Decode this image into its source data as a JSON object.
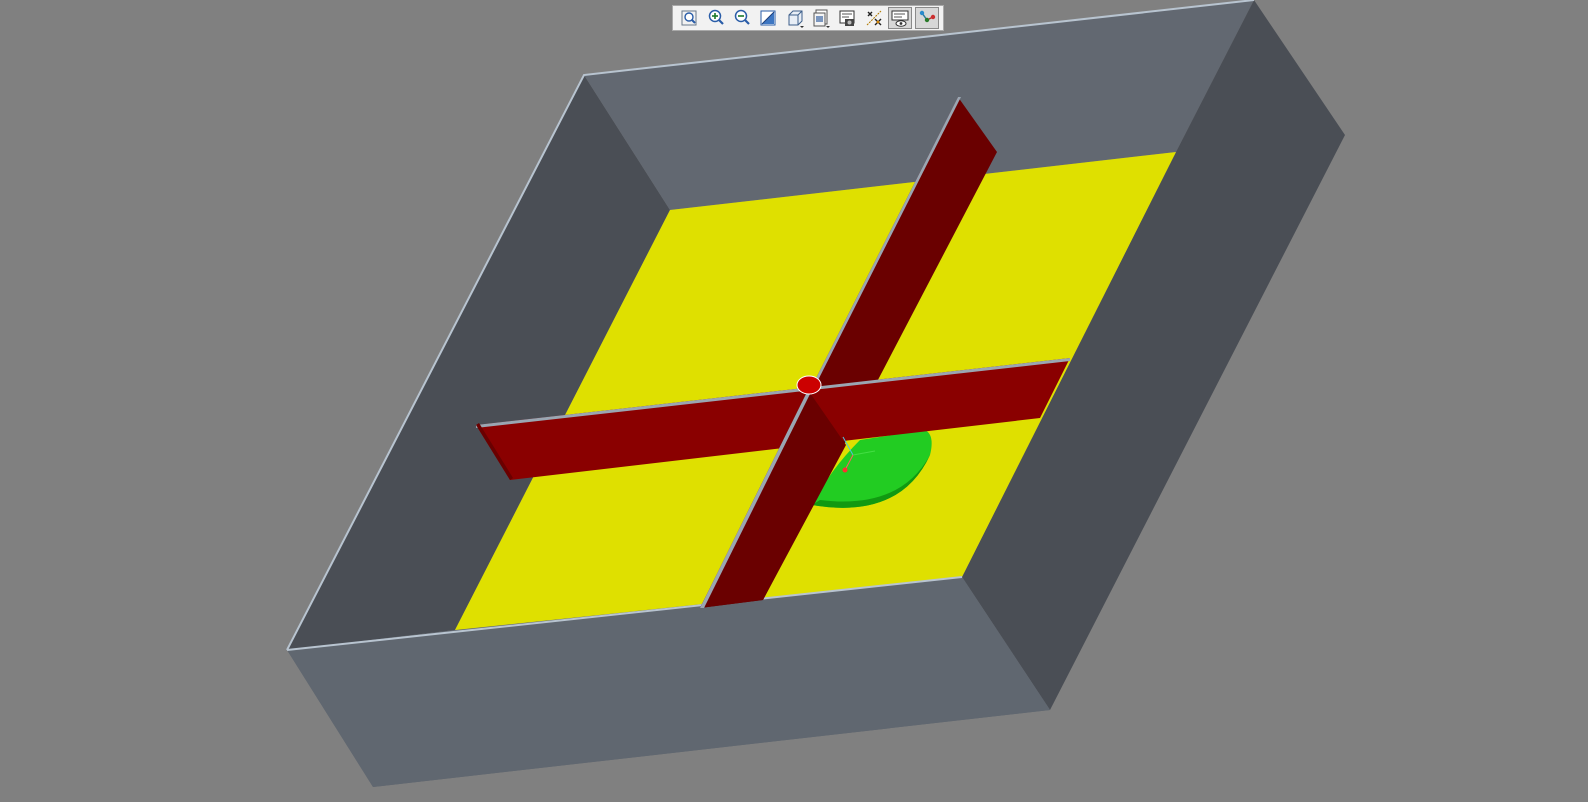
{
  "viewport": {
    "background_color": "#808080"
  },
  "colors": {
    "box_outer": "#606770",
    "box_wall_dark": "#4a4e55",
    "box_wall_light": "#646a73",
    "floor": "#dfe000",
    "beam": "#8a0000",
    "beam_dark": "#6a0000",
    "dome": "#22cc22",
    "edge_highlight": "#b8c4d0"
  },
  "toolbar": {
    "buttons": [
      {
        "icon": "zoom-fit-icon",
        "tooltip": "",
        "active": false
      },
      {
        "icon": "zoom-in-icon",
        "tooltip": "",
        "active": false
      },
      {
        "icon": "zoom-out-icon",
        "tooltip": "",
        "active": false
      },
      {
        "icon": "repaint-icon",
        "tooltip": "",
        "active": false
      },
      {
        "icon": "display-style-icon",
        "tooltip": "",
        "active": false
      },
      {
        "icon": "saved-views-icon",
        "tooltip": "",
        "active": false
      },
      {
        "icon": "view-manager-icon",
        "tooltip": "",
        "active": false
      },
      {
        "icon": "datum-display-icon",
        "tooltip": "",
        "active": false
      },
      {
        "icon": "annotation-display-icon",
        "tooltip": "",
        "active": true
      },
      {
        "icon": "spin-center-icon",
        "tooltip": "",
        "active": true
      }
    ]
  }
}
